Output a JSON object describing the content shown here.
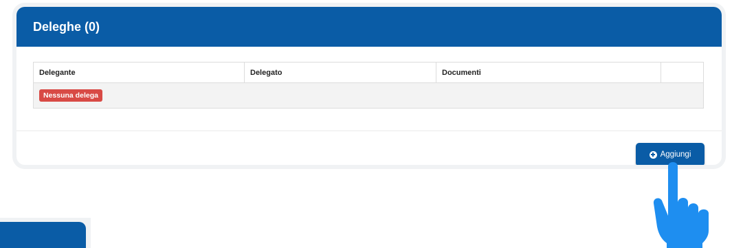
{
  "panel": {
    "title": "Deleghe (0)"
  },
  "table": {
    "columns": [
      "Delegante",
      "Delegato",
      "Documenti",
      ""
    ],
    "empty_label": "Nessuna delega"
  },
  "actions": {
    "add_label": "Aggiungi",
    "add_icon": "plus-circle-icon"
  },
  "overlay": {
    "pointer_icon": "pointing-hand-icon",
    "pointer_color": "#1e8ef0"
  },
  "colors": {
    "primary": "#0a5ca6",
    "danger": "#d84a45"
  }
}
